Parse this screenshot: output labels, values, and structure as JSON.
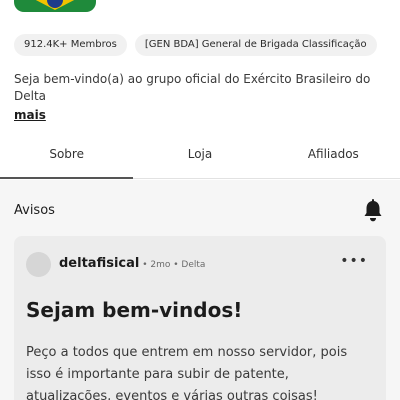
{
  "group": {
    "members_chip": "912.4K+ Membros",
    "rank_chip": "[GEN BDA] General de Brigada Classificação",
    "description": "Seja bem-vindo(a) ao grupo oficial do Exército Brasileiro do Delta",
    "more_label": "mais"
  },
  "tabs": [
    {
      "label": "Sobre",
      "active": true
    },
    {
      "label": "Loja",
      "active": false
    },
    {
      "label": "Afiliados",
      "active": false
    }
  ],
  "announcements": {
    "title": "Avisos",
    "notification_icon": "bell-icon",
    "post": {
      "author": "deltafisical",
      "meta": " • 2mo • Delta",
      "menu_icon": "more-options-icon",
      "menu_glyph": "•••",
      "title": "Sejam bem-vindos!",
      "body": "Peço a todos que entrem em nosso servidor, pois isso é importante para subir de patente, atualizações, eventos e várias outras coisas!"
    }
  },
  "colors": {
    "background": "#ffffff",
    "section_background": "#f6f6f6",
    "card_background": "#ececec",
    "chip_background": "#f1f1f1",
    "avatar_green": "#1f8a3b",
    "avatar_yellow": "#f2c200",
    "avatar_blue": "#1e3b8a"
  }
}
